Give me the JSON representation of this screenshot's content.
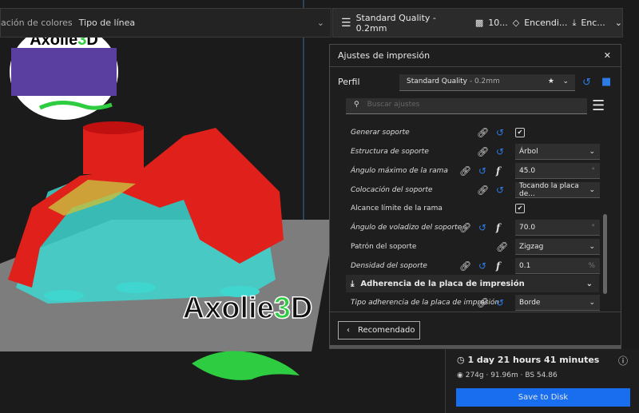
{
  "topbar": {
    "color_scheme_label": "ación de colores",
    "color_scheme_value": "Tipo de línea",
    "profile": "Standard Quality - 0.2mm",
    "infill": "10...",
    "support": "Encendi...",
    "adhesion": "Enc..."
  },
  "logo": {
    "text": "Axolie3D"
  },
  "watermark": {
    "text": "Axolie3D"
  },
  "panel": {
    "title": "Ajustes de impresión",
    "profile_label": "Perfil",
    "profile_value": "Standard Quality",
    "profile_suffix": " - 0.2mm",
    "search_placeholder": "Buscar ajustes",
    "settings": [
      {
        "label": "Generar soporte",
        "type": "checkbox",
        "checked": true
      },
      {
        "label": "Estructura de soporte",
        "type": "select",
        "value": "Árbol"
      },
      {
        "label": "Ángulo máximo de la rama",
        "type": "number",
        "value": "45.0",
        "unit": "°"
      },
      {
        "label": "Colocación del soporte",
        "type": "select",
        "value": "Tocando la placa de..."
      },
      {
        "label": "Alcance límite de la rama",
        "type": "checkbox",
        "checked": true
      },
      {
        "label": "Ángulo de voladizo del soporte",
        "type": "number",
        "value": "70.0",
        "unit": "°"
      },
      {
        "label": "Patrón del soporte",
        "type": "select",
        "value": "Zigzag"
      },
      {
        "label": "Densidad del soporte",
        "type": "number",
        "value": "0.1",
        "unit": "%"
      }
    ],
    "section": "Adherencia de la placa de impresión",
    "adhesion_setting": {
      "label": "Tipo adherencia de la placa de impresión",
      "value": "Borde"
    },
    "recommended_button": "Recomendado"
  },
  "estimate": {
    "time": "1 day 21 hours 41 minutes",
    "material": "274g · 91.96m · BS 54.86",
    "save_button": "Save to Disk"
  },
  "colors": {
    "accent": "#196ef0",
    "reset": "#2d7be5",
    "model_red": "#e0201a",
    "support_cyan": "#3fd6d0",
    "logo_green": "#2ecc40"
  }
}
